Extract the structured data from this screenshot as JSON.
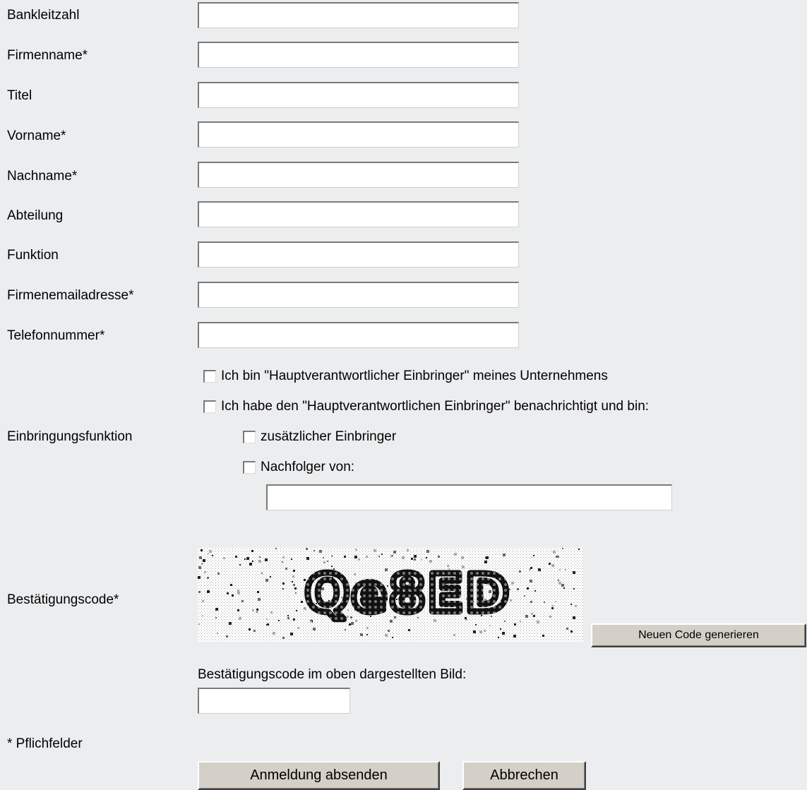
{
  "form": {
    "fields": [
      {
        "label": "Bankleitzahl",
        "value": ""
      },
      {
        "label": "Firmenname*",
        "value": ""
      },
      {
        "label": "Titel",
        "value": ""
      },
      {
        "label": "Vorname*",
        "value": ""
      },
      {
        "label": "Nachname*",
        "value": ""
      },
      {
        "label": "Abteilung",
        "value": ""
      },
      {
        "label": "Funktion",
        "value": ""
      },
      {
        "label": "Firmenemailadresse*",
        "value": ""
      },
      {
        "label": "Telefonnummer*",
        "value": ""
      }
    ],
    "einbringung": {
      "label": "Einbringungsfunktion",
      "option_haupt": "Ich bin \"Hauptverantwortlicher Einbringer\" meines Unternehmens",
      "option_benachrichtigt": "Ich habe den \"Hauptverantwortlichen Einbringer\" benachrichtigt und bin:",
      "option_zusaetzlich": "zusätzlicher Einbringer",
      "option_nachfolger": "Nachfolger von:",
      "nachfolger_value": "",
      "checked": {
        "haupt": false,
        "benachrichtigt": false,
        "zusaetzlich": false,
        "nachfolger": false
      }
    },
    "captcha": {
      "label": "Bestätigungscode*",
      "image_text": "Qe8ED",
      "regenerate_label": "Neuen Code generieren",
      "input_label": "Bestätigungscode im oben dargestellten Bild:",
      "input_value": ""
    },
    "required_note": "* Pflichfelder",
    "submit_label": "Anmeldung absenden",
    "cancel_label": "Abbrechen"
  }
}
